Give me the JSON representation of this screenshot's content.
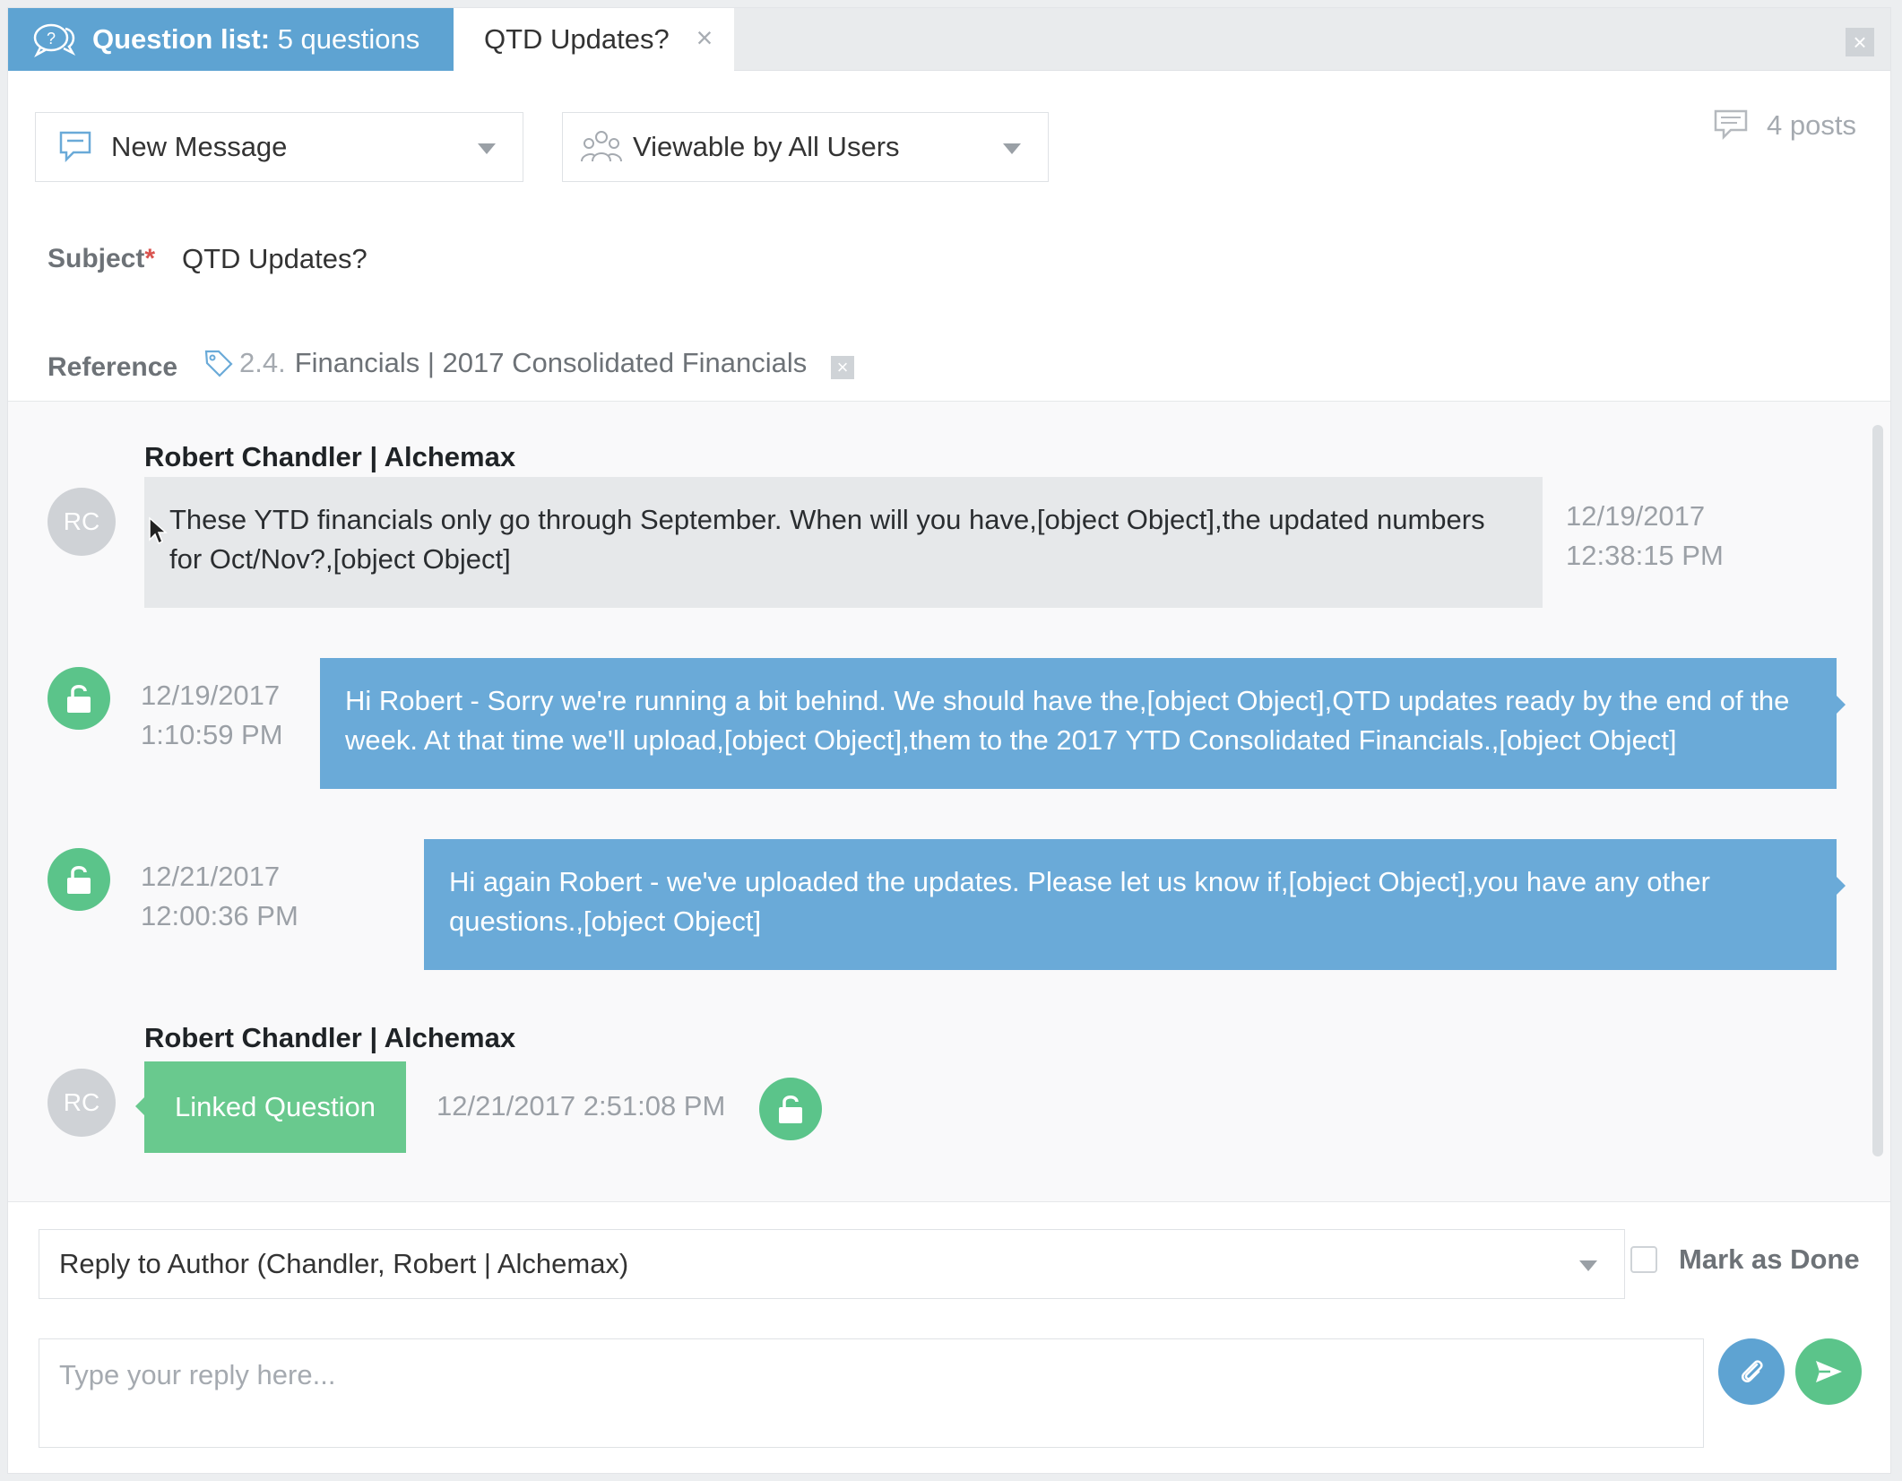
{
  "tabs": {
    "questions_prefix": "Question list:",
    "questions_count": "5 questions",
    "active_tab": "QTD Updates?",
    "tab_close": "×",
    "window_close": "×"
  },
  "header": {
    "message_type": "New Message",
    "visibility": "Viewable by All Users",
    "posts": "4 posts"
  },
  "subject": {
    "label": "Subject",
    "required": "*",
    "value": "QTD Updates?"
  },
  "reference": {
    "label": "Reference",
    "number": "2.4.",
    "path": "Financials | 2017 Consolidated Financials",
    "remove": "×"
  },
  "messages": [
    {
      "author": "Robert Chandler | Alchemax",
      "initials": "RC",
      "text": "These YTD financials only go through September. When will you have,[object Object],the updated numbers for Oct/Nov?,[object Object]",
      "date": "12/19/2017",
      "time": "12:38:15 PM"
    },
    {
      "text": "Hi Robert - Sorry we're running a bit behind. We should have the,[object Object],QTD updates ready by the end of the week. At that time we'll upload,[object Object],them to the 2017 YTD Consolidated Financials.,[object Object]",
      "date": "12/19/2017",
      "time": "1:10:59 PM"
    },
    {
      "text": "Hi again Robert - we've uploaded the updates. Please let us know if,[object Object],you have any other questions.,[object Object]",
      "date": "12/21/2017",
      "time": "12:00:36 PM"
    },
    {
      "author": "Robert Chandler | Alchemax",
      "initials": "RC",
      "linked_label": "Linked Question",
      "timestamp": "12/21/2017 2:51:08 PM"
    }
  ],
  "reply": {
    "recipient": "Reply to Author (Chandler, Robert | Alchemax)",
    "mark_done": "Mark as Done",
    "placeholder": "Type your reply here..."
  },
  "colors": {
    "tab_blue": "#5ea3d2",
    "bubble_blue": "#6aaad8",
    "green": "#5bc48a",
    "attach_blue": "#5ea3d2",
    "send_green": "#5bc48a"
  }
}
